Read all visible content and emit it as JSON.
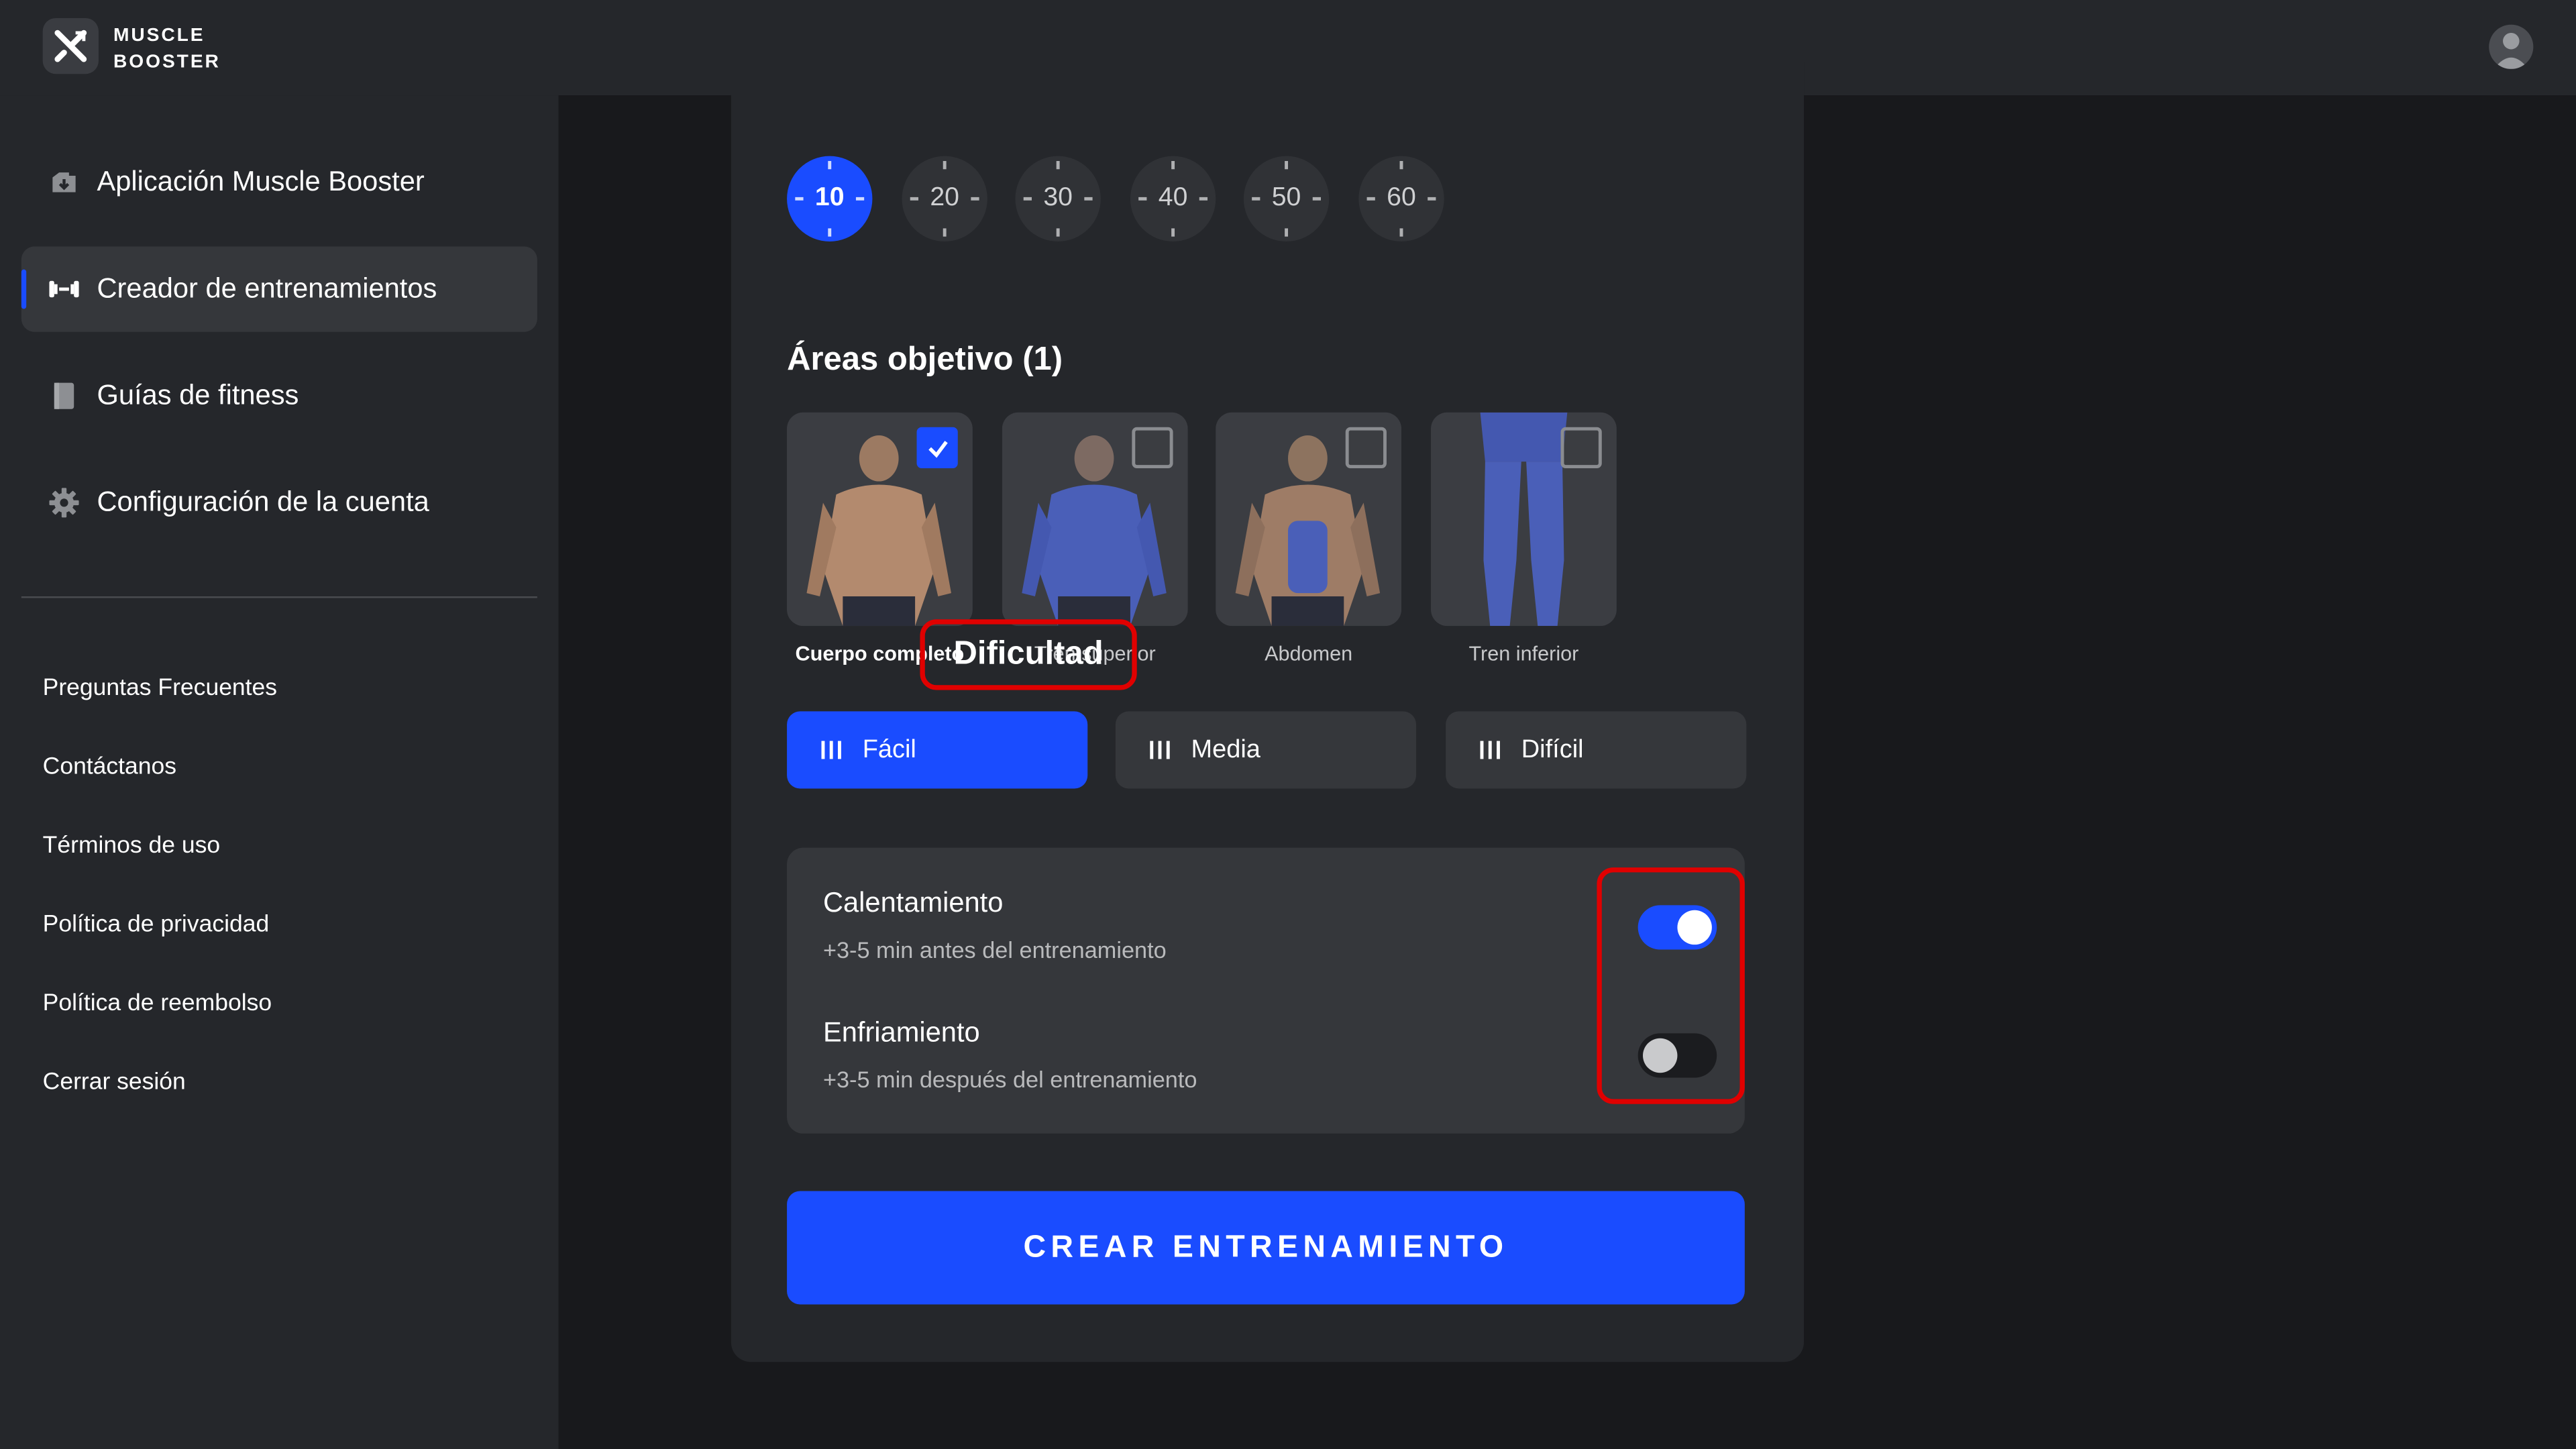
{
  "brand": {
    "line1": "MUSCLE",
    "line2": "BOOSTER"
  },
  "sidebar": {
    "items": [
      {
        "label": "Aplicación Muscle Booster",
        "icon": "download-cloud-icon"
      },
      {
        "label": "Creador de entrenamientos",
        "icon": "dumbbell-icon",
        "active": true
      },
      {
        "label": "Guías de fitness",
        "icon": "book-icon"
      },
      {
        "label": "Configuración de la cuenta",
        "icon": "gear-icon"
      }
    ],
    "links": [
      "Preguntas Frecuentes",
      "Contáctanos",
      "Términos de uso",
      "Política de privacidad",
      "Política de reembolso",
      "Cerrar sesión"
    ]
  },
  "duration": {
    "options": [
      "10",
      "20",
      "30",
      "40",
      "50",
      "60"
    ],
    "selected": "10"
  },
  "areas": {
    "title": "Áreas objetivo (1)",
    "items": [
      {
        "label": "Cuerpo completo",
        "checked": true
      },
      {
        "label": "Tren superior",
        "checked": false
      },
      {
        "label": "Abdomen",
        "checked": false
      },
      {
        "label": "Tren inferior",
        "checked": false
      }
    ]
  },
  "difficulty": {
    "title": "Dificultad",
    "options": [
      "Fácil",
      "Media",
      "Difícil"
    ],
    "selected": "Fácil"
  },
  "options": {
    "warmup": {
      "title": "Calentamiento",
      "subtitle": "+3-5 min antes del entrenamiento",
      "enabled": true
    },
    "cooldown": {
      "title": "Enfriamiento",
      "subtitle": "+3-5 min después del entrenamiento",
      "enabled": false
    }
  },
  "cta": {
    "label": "CREAR ENTRENAMIENTO"
  },
  "colors": {
    "accent": "#1a4cff",
    "highlight": "#e00000",
    "surface": "#25272b",
    "background": "#18191c"
  }
}
